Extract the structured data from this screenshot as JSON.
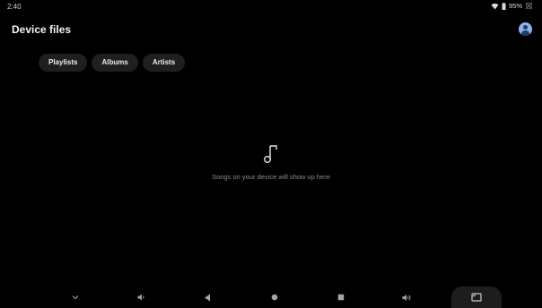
{
  "status_bar": {
    "time": "2:40",
    "battery": "95%"
  },
  "header": {
    "title": "Device files"
  },
  "chips": [
    {
      "label": "Playlists"
    },
    {
      "label": "Albums"
    },
    {
      "label": "Artists"
    }
  ],
  "empty_state": {
    "icon": "music-note-icon",
    "message": "Songs on your device will show up here"
  },
  "nav_bar": {
    "icons": [
      "chevron-down-icon",
      "volume-down-icon",
      "back-icon",
      "home-icon",
      "recents-icon",
      "volume-up-icon",
      "screenshot-icon"
    ]
  },
  "colors": {
    "background": "#000000",
    "chip_background": "#1f1f1f",
    "avatar": "#8fb4ea",
    "secondary_text": "#8a8a8a"
  }
}
